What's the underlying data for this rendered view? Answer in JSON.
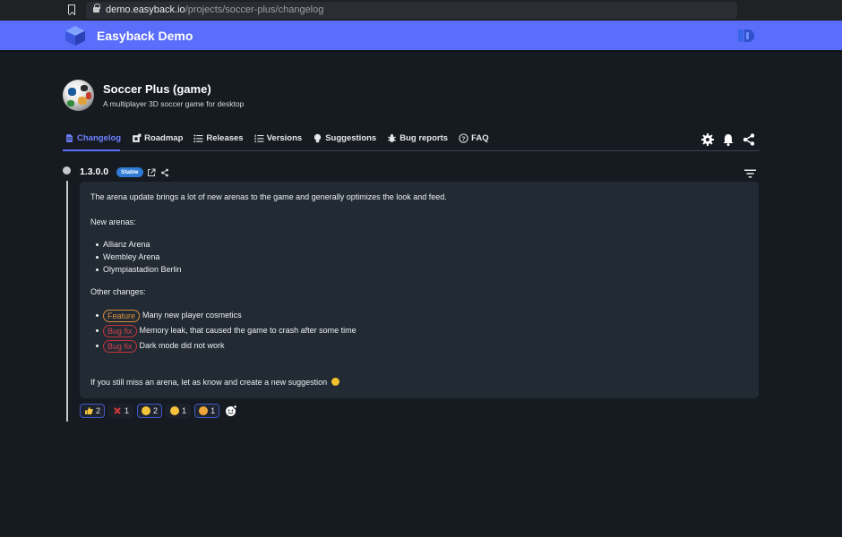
{
  "browser": {
    "url_domain": "demo.easyback.io",
    "url_path": "/projects/soccer-plus/changelog"
  },
  "app": {
    "title": "Easyback Demo"
  },
  "project": {
    "title": "Soccer Plus (game)",
    "subtitle": "A multiplayer 3D soccer game for desktop"
  },
  "tabs": [
    {
      "label": "Changelog",
      "icon": "document-icon",
      "active": true
    },
    {
      "label": "Roadmap",
      "icon": "roadmap-icon"
    },
    {
      "label": "Releases",
      "icon": "list-icon"
    },
    {
      "label": "Versions",
      "icon": "list-numbered-icon"
    },
    {
      "label": "Suggestions",
      "icon": "lightbulb-icon"
    },
    {
      "label": "Bug reports",
      "icon": "bug-icon"
    },
    {
      "label": "FAQ",
      "icon": "question-icon"
    }
  ],
  "release": {
    "version": "1.3.0.0",
    "badge": "Stable",
    "intro": "The arena update brings a lot of new arenas to the game and generally optimizes the look and feed.",
    "new_arenas_heading": "New arenas:",
    "arenas": [
      "Allianz Arena",
      "Wembley Arena",
      "Olympiastadion Berlin"
    ],
    "other_heading": "Other changes:",
    "changes": [
      {
        "tag": "Feature",
        "text": "Many new player cosmetics"
      },
      {
        "tag": "Bug fix",
        "text": "Memory leak, that caused the game to crash after some time"
      },
      {
        "tag": "Bug fix",
        "text": "Dark mode did not work"
      }
    ],
    "outro": "If you still miss an arena, let as know and create a new suggestion"
  },
  "reactions": [
    {
      "emoji": "thumbs-up",
      "count": "2",
      "highlight": true
    },
    {
      "emoji": "x-mark",
      "count": "1",
      "highlight": false
    },
    {
      "emoji": "grinning-face",
      "count": "2",
      "highlight": true
    },
    {
      "emoji": "smiley",
      "count": "1",
      "highlight": false
    },
    {
      "emoji": "cat-face",
      "count": "1",
      "highlight": true
    }
  ],
  "colors": {
    "accent": "#5a6dfb",
    "background": "#161b22",
    "card": "#222a34",
    "feature": "#e0943f",
    "bug": "#d1434a",
    "stable": "#2f7bd6"
  }
}
